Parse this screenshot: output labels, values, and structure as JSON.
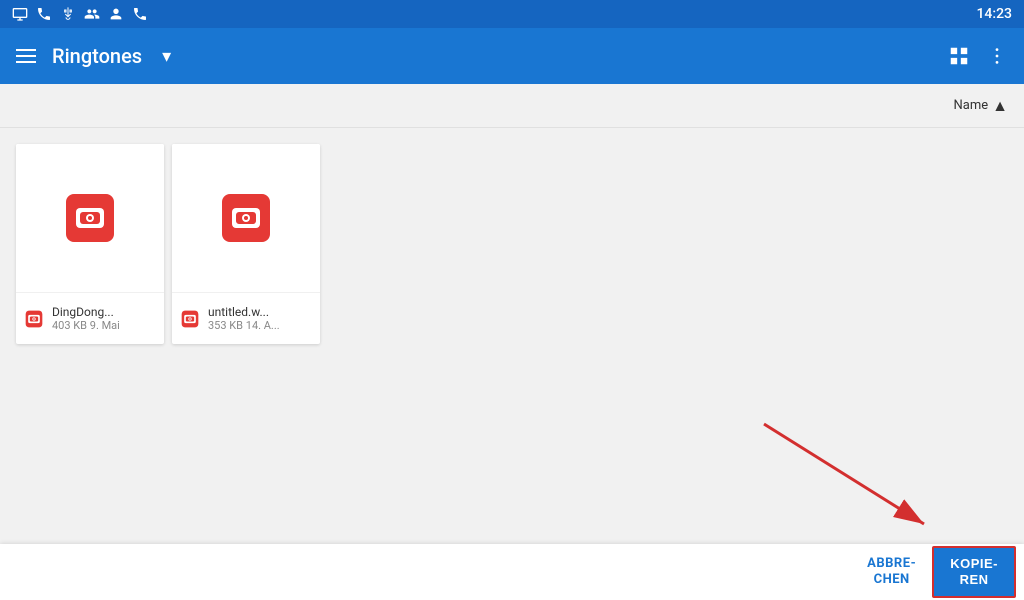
{
  "statusBar": {
    "time": "14:23",
    "icons": [
      "screen-icon",
      "phone-icon",
      "usb-icon",
      "contacts-icon",
      "person-icon",
      "call-icon"
    ]
  },
  "appBar": {
    "title": "Ringtones",
    "dropdownArrow": "▾",
    "hamburgerLabel": "Menu",
    "gridViewLabel": "Grid view",
    "moreOptionsLabel": "More options"
  },
  "sortBar": {
    "label": "Name",
    "arrowUp": "▲"
  },
  "files": [
    {
      "name": "DingDong...",
      "meta": "403 KB 9. Mai"
    },
    {
      "name": "untitled.w...",
      "meta": "353 KB 14. A..."
    }
  ],
  "bottomBar": {
    "cancelLabel": "ABBRE-\nCHEN",
    "copyLabel": "KOPIE-\nREN"
  }
}
